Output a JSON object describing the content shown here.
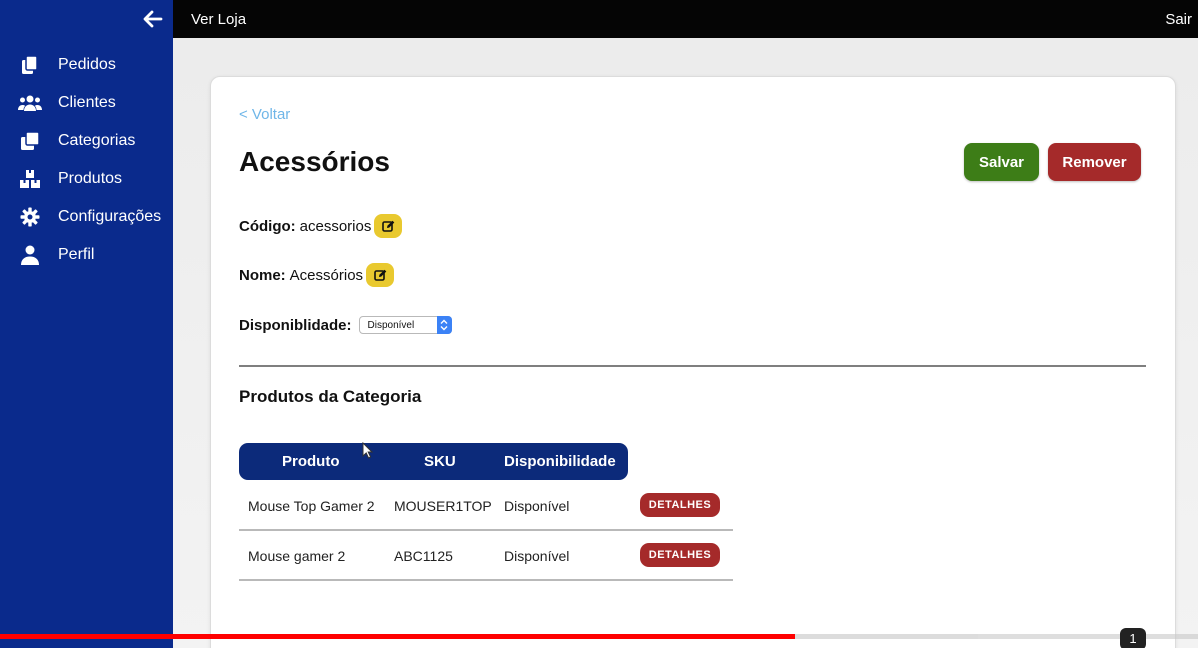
{
  "topbar": {
    "store_link": "Ver Loja",
    "logout": "Sair"
  },
  "sidebar": {
    "items": [
      {
        "label": "Pedidos",
        "icon": "copy-icon"
      },
      {
        "label": "Clientes",
        "icon": "users-icon"
      },
      {
        "label": "Categorias",
        "icon": "clone-icon"
      },
      {
        "label": "Produtos",
        "icon": "boxes-icon"
      },
      {
        "label": "Configurações",
        "icon": "gear-icon"
      },
      {
        "label": "Perfil",
        "icon": "user-icon"
      }
    ]
  },
  "page": {
    "back_link": "< Voltar",
    "title": "Acessórios",
    "save_label": "Salvar",
    "remove_label": "Remover",
    "code_label": "Código:",
    "code_value": "acessorios",
    "name_label": "Nome:",
    "name_value": "Acessórios",
    "availability_label": "Disponiblidade:",
    "availability_value": "Disponível",
    "section_title": "Produtos da Categoria"
  },
  "table": {
    "headers": [
      "Produto",
      "SKU",
      "Disponibilidade"
    ],
    "rows": [
      {
        "product": "Mouse Top Gamer 2",
        "sku": "MOUSER1TOP",
        "availability": "Disponível",
        "action": "DETALHES"
      },
      {
        "product": "Mouse gamer 2",
        "sku": "ABC1125",
        "availability": "Disponível",
        "action": "DETALHES"
      }
    ]
  },
  "video": {
    "progress": 0.664,
    "badge": "1"
  },
  "colors": {
    "sidebar": "#0a2a8c",
    "table_header": "#0c2a7a",
    "save": "#3d7d17",
    "remove": "#a52a2a",
    "edit": "#e9c92f",
    "link": "#6fb6e8"
  }
}
